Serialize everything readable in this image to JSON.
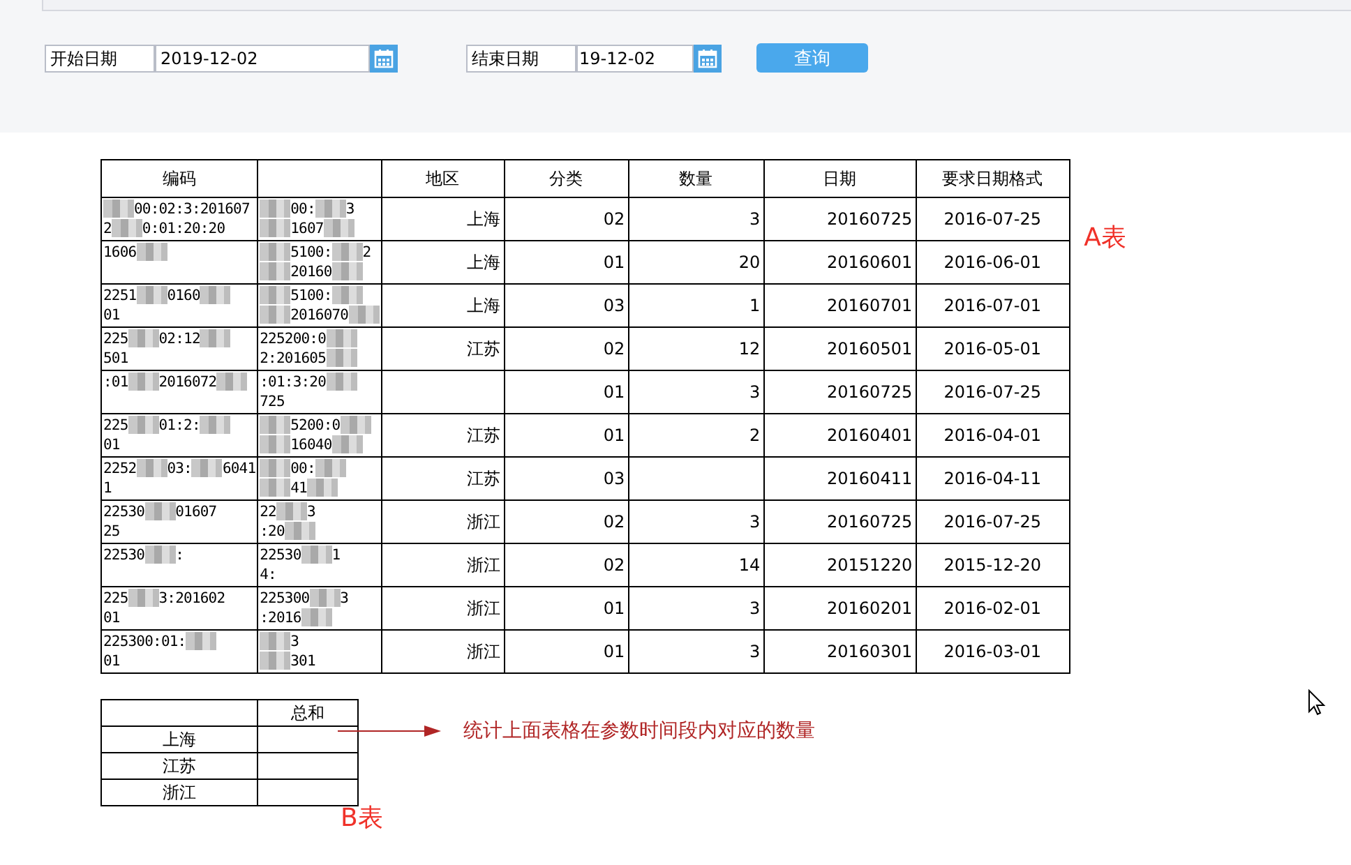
{
  "query_bar": {
    "start": {
      "label": "开始日期",
      "value": "2019-12-02"
    },
    "end": {
      "label": "结束日期",
      "value": "19-12-02"
    },
    "button": "查询"
  },
  "table_a": {
    "columns": [
      {
        "label": "编码"
      },
      {},
      {
        "label": "地区"
      },
      {
        "label": "分类"
      },
      {
        "label": "数量"
      },
      {
        "label": "日期"
      },
      {
        "label": "要求日期格式"
      }
    ],
    "rows": [
      {
        "code": [
          [
            {
              "kind": "mosaic"
            },
            {
              "text": "00:02:3:201607"
            }
          ],
          [
            {
              "text": "2"
            },
            {
              "kind": "mosaic"
            },
            {
              "text": "0:01:20:20"
            }
          ]
        ],
        "column_2": [
          [
            {
              "kind": "mosaic"
            },
            {
              "text": "00:"
            },
            {
              "kind": "mosaic"
            },
            {
              "text": "3"
            }
          ],
          [
            {
              "kind": "mosaic"
            },
            {
              "text": "1607"
            },
            {
              "kind": "mosaic"
            }
          ]
        ],
        "region": "上海",
        "category": "02",
        "quantity": "3",
        "date": "20160725",
        "formatted_date": "2016-07-25"
      },
      {
        "code": [
          [
            {
              "text": "1606"
            },
            {
              "kind": "mosaic"
            }
          ]
        ],
        "column_2": [
          [
            {
              "kind": "mosaic"
            },
            {
              "text": "5100:"
            },
            {
              "kind": "mosaic"
            },
            {
              "text": "2"
            }
          ],
          [
            {
              "kind": "mosaic"
            },
            {
              "text": "20160"
            },
            {
              "kind": "mosaic"
            }
          ]
        ],
        "region": "上海",
        "category": "01",
        "quantity": "20",
        "date": "20160601",
        "formatted_date": "2016-06-01"
      },
      {
        "code": [
          [
            {
              "text": "2251"
            },
            {
              "kind": "mosaic"
            },
            {
              "text": "0160"
            },
            {
              "kind": "mosaic"
            }
          ],
          [
            {
              "text": "01"
            }
          ]
        ],
        "column_2": [
          [
            {
              "kind": "mosaic"
            },
            {
              "text": "5100:"
            },
            {
              "kind": "mosaic"
            }
          ],
          [
            {
              "kind": "mosaic"
            },
            {
              "text": "2016070"
            },
            {
              "kind": "mosaic"
            }
          ]
        ],
        "region": "上海",
        "category": "03",
        "quantity": "1",
        "date": "20160701",
        "formatted_date": "2016-07-01"
      },
      {
        "code": [
          [
            {
              "text": "225"
            },
            {
              "kind": "mosaic"
            },
            {
              "text": "02:12"
            },
            {
              "kind": "mosaic"
            }
          ],
          [
            {
              "text": "501"
            }
          ]
        ],
        "column_2": [
          [
            {
              "text": "225200:0"
            },
            {
              "kind": "mosaic"
            }
          ],
          [
            {
              "text": "2:201605"
            },
            {
              "kind": "mosaic"
            }
          ]
        ],
        "region": "江苏",
        "category": "02",
        "quantity": "12",
        "date": "20160501",
        "formatted_date": "2016-05-01"
      },
      {
        "code": [
          [
            {
              "text": ":01"
            },
            {
              "kind": "mosaic"
            },
            {
              "text": "2016072"
            },
            {
              "kind": "mosaic"
            }
          ]
        ],
        "column_2": [
          [
            {
              "text": ":01:3:20"
            },
            {
              "kind": "mosaic"
            }
          ],
          [
            {
              "text": "725"
            }
          ]
        ],
        "category": "01",
        "quantity": "3",
        "date": "20160725",
        "formatted_date": "2016-07-25"
      },
      {
        "code": [
          [
            {
              "text": "225"
            },
            {
              "kind": "mosaic"
            },
            {
              "text": "01:2:"
            },
            {
              "kind": "mosaic"
            }
          ],
          [
            {
              "text": "01"
            }
          ]
        ],
        "column_2": [
          [
            {
              "kind": "mosaic"
            },
            {
              "text": "5200:0"
            },
            {
              "kind": "mosaic"
            }
          ],
          [
            {
              "kind": "mosaic"
            },
            {
              "text": "16040"
            },
            {
              "kind": "mosaic"
            }
          ]
        ],
        "region": "江苏",
        "category": "01",
        "quantity": "2",
        "date": "20160401",
        "formatted_date": "2016-04-01"
      },
      {
        "code": [
          [
            {
              "text": "2252"
            },
            {
              "kind": "mosaic"
            },
            {
              "text": "03:"
            },
            {
              "kind": "mosaic"
            },
            {
              "text": "6041"
            }
          ],
          [
            {
              "text": "1"
            }
          ]
        ],
        "column_2": [
          [
            {
              "kind": "mosaic"
            },
            {
              "text": "00:"
            },
            {
              "kind": "mosaic"
            }
          ],
          [
            {
              "kind": "mosaic"
            },
            {
              "text": "41"
            },
            {
              "kind": "mosaic"
            }
          ]
        ],
        "region": "江苏",
        "category": "03",
        "date": "20160411",
        "formatted_date": "2016-04-11"
      },
      {
        "code": [
          [
            {
              "text": "22530"
            },
            {
              "kind": "mosaic"
            },
            {
              "text": "01607"
            }
          ],
          [
            {
              "text": "25"
            }
          ]
        ],
        "column_2": [
          [
            {
              "text": "22"
            },
            {
              "kind": "mosaic"
            },
            {
              "text": "3"
            }
          ],
          [
            {
              "text": ":20"
            },
            {
              "kind": "mosaic"
            }
          ]
        ],
        "region": "浙江",
        "category": "02",
        "quantity": "3",
        "date": "20160725",
        "formatted_date": "2016-07-25"
      },
      {
        "code": [
          [
            {
              "text": "22530"
            },
            {
              "kind": "mosaic"
            },
            {
              "text": ":"
            }
          ]
        ],
        "column_2": [
          [
            {
              "text": "22530"
            },
            {
              "kind": "mosaic"
            },
            {
              "text": "1"
            }
          ],
          [
            {
              "text": "4:"
            }
          ]
        ],
        "region": "浙江",
        "category": "02",
        "quantity": "14",
        "date": "20151220",
        "formatted_date": "2015-12-20"
      },
      {
        "code": [
          [
            {
              "text": "225"
            },
            {
              "kind": "mosaic"
            },
            {
              "text": "3:201602"
            }
          ],
          [
            {
              "text": "01"
            }
          ]
        ],
        "column_2": [
          [
            {
              "text": "225300"
            },
            {
              "kind": "mosaic"
            },
            {
              "text": "3"
            }
          ],
          [
            {
              "text": ":2016"
            },
            {
              "kind": "mosaic"
            }
          ]
        ],
        "region": "浙江",
        "category": "01",
        "quantity": "3",
        "date": "20160201",
        "formatted_date": "2016-02-01"
      },
      {
        "code": [
          [
            {
              "text": "225300:01:"
            },
            {
              "kind": "mosaic"
            }
          ],
          [
            {
              "text": "01"
            }
          ]
        ],
        "column_2": [
          [
            {
              "kind": "mosaic"
            },
            {
              "text": "3"
            }
          ],
          [
            {
              "kind": "mosaic"
            },
            {
              "text": "301"
            }
          ]
        ],
        "region": "浙江",
        "category": "01",
        "quantity": "3",
        "date": "20160301",
        "formatted_date": "2016-03-01"
      }
    ]
  },
  "table_a_label": "A表",
  "table_b": {
    "header": "总和",
    "rows": [
      "上海",
      "江苏",
      "浙江"
    ]
  },
  "note": "统计上面表格在参数时间段内对应的数量",
  "table_b_label": "B表"
}
